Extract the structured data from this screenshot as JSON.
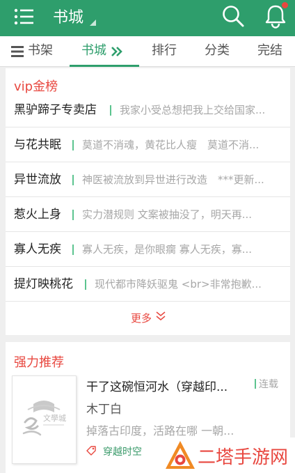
{
  "header": {
    "title": "书城"
  },
  "tabs": [
    {
      "label": "书架"
    },
    {
      "label": "书城"
    },
    {
      "label": "排行"
    },
    {
      "label": "分类"
    },
    {
      "label": "完结"
    }
  ],
  "vip_section": {
    "title": "vip金榜",
    "items": [
      {
        "title": "黑驴蹄子专卖店",
        "desc": "我家小受总想把我上交给国家..."
      },
      {
        "title": "与花共眠",
        "desc": "莫道不消魂，黄花比人瘦　莫道不消..."
      },
      {
        "title": "异世流放",
        "desc": "神医被流放到异世进行改造　***更新..."
      },
      {
        "title": "惹火上身",
        "desc": "实力潜规则 文案被抽没了，明天再..."
      },
      {
        "title": "寡人无疾",
        "desc": "寡人无疾，是你眼瘸 寡人无疾，寡..."
      },
      {
        "title": "提灯映桃花",
        "desc": "现代都市降妖驱鬼 <br>非常抱歉..."
      }
    ],
    "more_label": "更多"
  },
  "recommend_section": {
    "title": "强力推荐",
    "book": {
      "title": "干了这碗恒河水（穿越印...",
      "status": "连载",
      "author": "木丁白",
      "desc": "掉落古印度，活路在哪 一朝...",
      "tag": "穿越时空",
      "cover_text": "文學城"
    }
  },
  "watermark": {
    "text": "二塔手游网"
  },
  "colors": {
    "primary": "#2e9e6c",
    "accent_red": "#e8473f",
    "divider_green": "#5cc48f",
    "muted_text": "#a7a7a7",
    "background": "#efefef"
  }
}
